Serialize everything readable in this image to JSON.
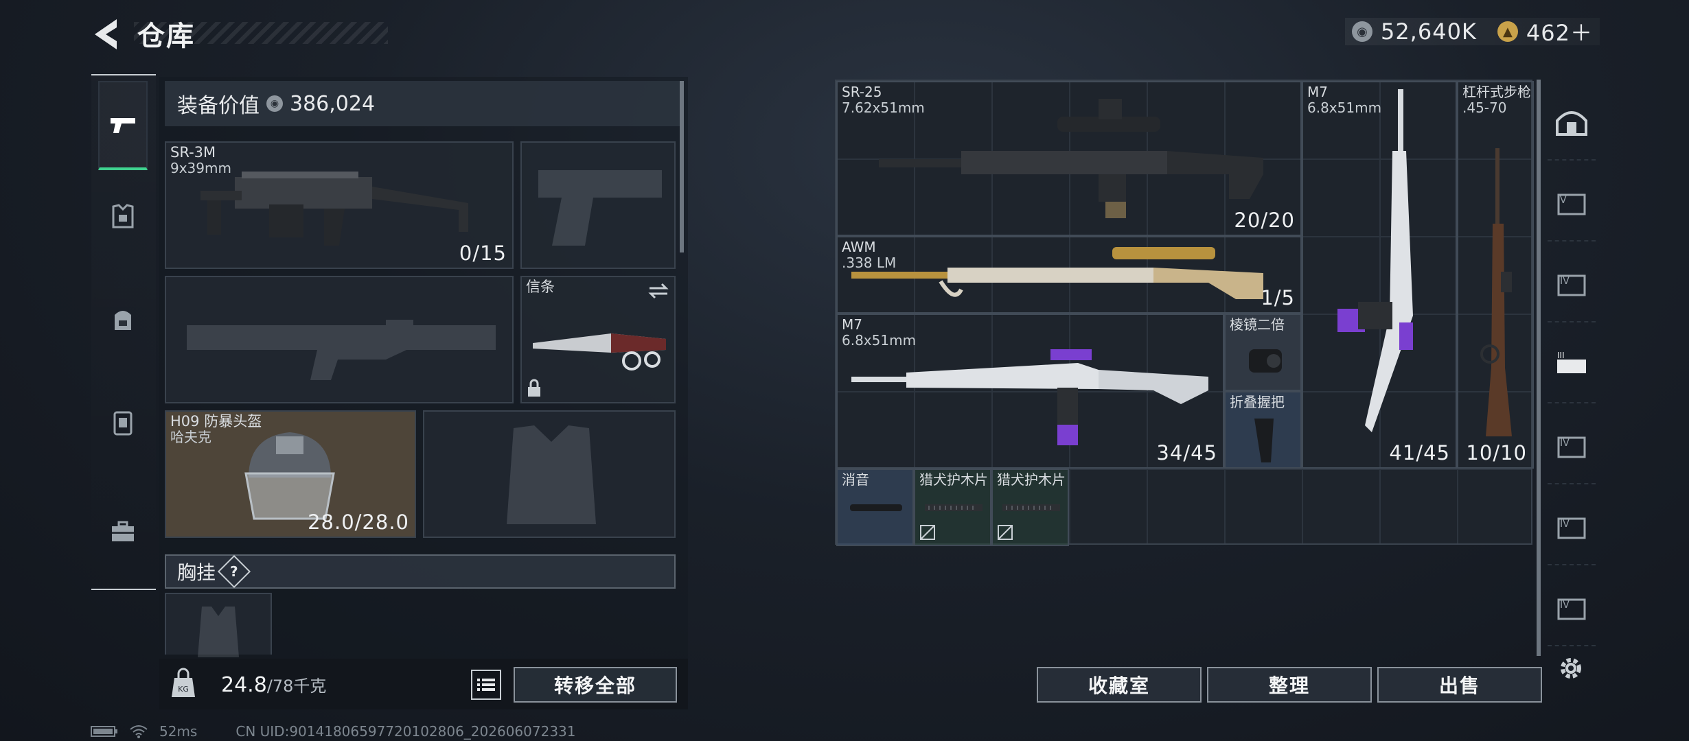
{
  "header": {
    "title": "仓库",
    "currency": [
      {
        "icon": "silver-coin-icon",
        "value": "52,640K"
      },
      {
        "icon": "gold-coin-icon",
        "value": "462＋"
      }
    ]
  },
  "left_panel": {
    "equip_value_label": "装备价值",
    "equip_value": "386,024",
    "primary_weapon": {
      "name": "SR-3M",
      "caliber": "9x39mm",
      "count": "0/15"
    },
    "melee": {
      "name": "信条"
    },
    "helmet": {
      "name": "H09 防暴头盔",
      "sub": "哈夫克",
      "durability": "28.0/28.0"
    },
    "chest_rig_label": "胸挂",
    "chest_rig_help": "?",
    "weight_current": "24.8",
    "weight_max": "/78千克",
    "transfer_all": "转移全部"
  },
  "stash": {
    "items": [
      {
        "name": "SR-25",
        "caliber": "7.62x51mm",
        "count": "20/20"
      },
      {
        "name": "AWM",
        "caliber": ".338 LM",
        "count": "1/5"
      },
      {
        "name": "M7",
        "caliber": "6.8x51mm",
        "count": "34/45"
      },
      {
        "name": "棱镜二倍"
      },
      {
        "name": "折叠握把"
      },
      {
        "name": "M7",
        "caliber": "6.8x51mm",
        "count": "41/45"
      },
      {
        "name": "杠杆式步枪",
        "caliber": ".45-70",
        "count": "10/10"
      },
      {
        "name": "消音"
      },
      {
        "name": "猎犬护木片"
      },
      {
        "name": "猎犬护木片"
      }
    ],
    "buttons": {
      "vault": "收藏室",
      "sort": "整理",
      "sell": "出售"
    }
  },
  "status_bar": {
    "ping": "52ms",
    "uid": "CN UID:90141806597720102806_202606072331"
  },
  "colors": {
    "accent_green": "#3fd28f",
    "purple": "#7a3fd0"
  }
}
